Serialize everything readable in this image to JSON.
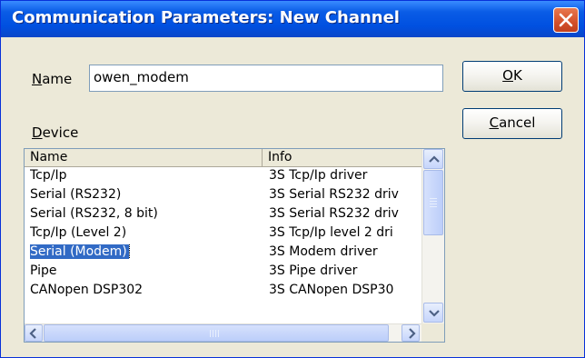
{
  "window": {
    "title": "Communication Parameters: New Channel"
  },
  "name_field": {
    "label_key": "N",
    "label_rest": "ame",
    "value": "owen_modem"
  },
  "device": {
    "label_key": "D",
    "label_rest": "evice"
  },
  "buttons": {
    "ok": {
      "key": "O",
      "rest": "K"
    },
    "cancel": {
      "key": "C",
      "rest": "ancel"
    }
  },
  "table": {
    "columns": [
      "Name",
      "Info"
    ],
    "rows": [
      {
        "name": "Tcp/Ip",
        "info": "3S Tcp/Ip driver"
      },
      {
        "name": "Serial (RS232)",
        "info": "3S Serial RS232 driv"
      },
      {
        "name": "Serial (RS232, 8 bit)",
        "info": "3S Serial RS232 driv"
      },
      {
        "name": "Tcp/Ip (Level 2)",
        "info": "3S Tcp/Ip level 2 dri"
      },
      {
        "name": "Serial (Modem)",
        "info": "3S Modem driver",
        "selected": true
      },
      {
        "name": "Pipe",
        "info": "3S Pipe driver"
      },
      {
        "name": "CANopen DSP302",
        "info": "3S CANopen DSP30"
      }
    ]
  },
  "colors": {
    "titlebar": "#0A5CE6",
    "selection": "#316AC5",
    "window_bg": "#ECE9D8",
    "close": "#D4502A"
  }
}
